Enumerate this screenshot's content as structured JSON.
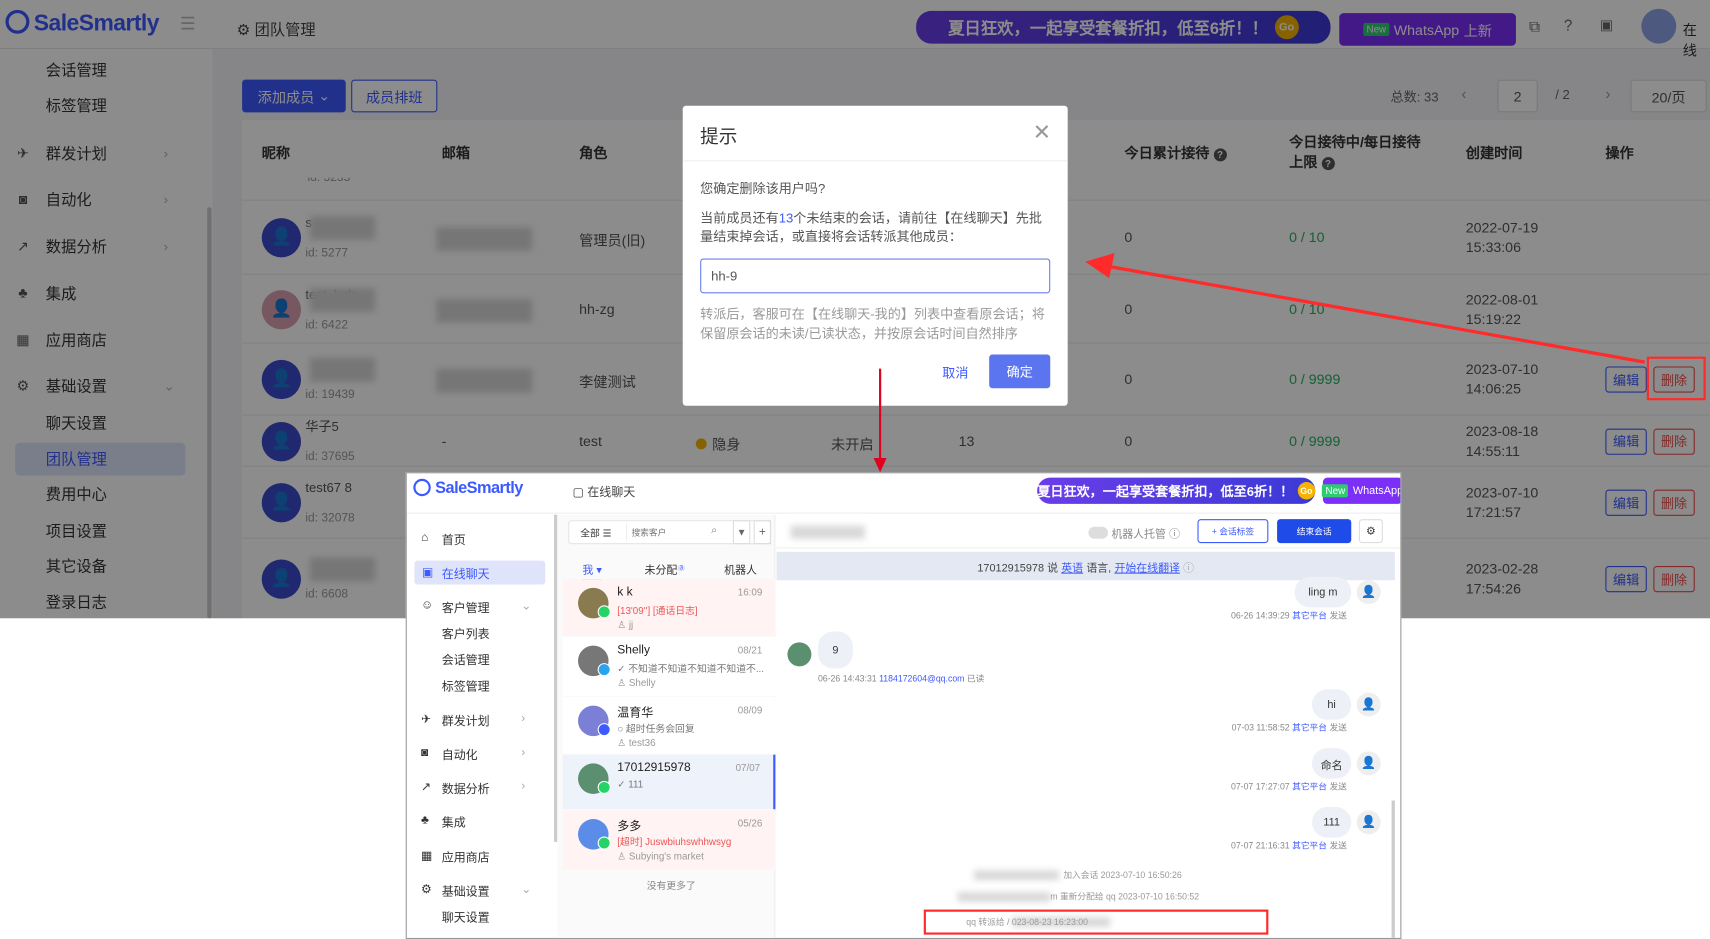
{
  "app": {
    "logo": "SaleSmartly",
    "breadcrumb": "团队管理",
    "banner": "夏日狂欢，一起享受套餐折扣，低至6折！！",
    "banner_go": "Go",
    "wa_new": "New",
    "wa_label": "WhatsApp",
    "wa_suffix": "上新",
    "user_status": "在线"
  },
  "sidebar": [
    {
      "label": "会话管理",
      "icon": ""
    },
    {
      "label": "标签管理",
      "icon": ""
    },
    {
      "label": "群发计划",
      "icon": "send-icon",
      "chevron": "›"
    },
    {
      "label": "自动化",
      "icon": "robot-icon",
      "chevron": "›"
    },
    {
      "label": "数据分析",
      "icon": "chart-icon",
      "chevron": "›"
    },
    {
      "label": "集成",
      "icon": "integration-icon"
    },
    {
      "label": "应用商店",
      "icon": "apps-icon"
    },
    {
      "label": "基础设置",
      "icon": "gear-icon",
      "chevron": "⌄"
    },
    {
      "label": "聊天设置",
      "icon": ""
    },
    {
      "label": "团队管理",
      "icon": "",
      "active": true
    },
    {
      "label": "费用中心",
      "icon": ""
    },
    {
      "label": "项目设置",
      "icon": ""
    },
    {
      "label": "其它设备",
      "icon": ""
    },
    {
      "label": "登录日志",
      "icon": ""
    }
  ],
  "toolbar": {
    "add_member": "添加成员",
    "schedule": "成员排班",
    "total": "总数: 33",
    "page": "2",
    "pages": "/ 2",
    "page_size": "20/页",
    "prev": "‹",
    "next": "›"
  },
  "table": {
    "headers": {
      "nick": "昵称",
      "email": "邮箱",
      "role": "角色",
      "today_total": "今日累计接待",
      "today_limit": "今日接待中/每日接待上限",
      "created": "创建时间",
      "ops": "操作"
    },
    "partial_id": "id: 3235",
    "rows": [
      {
        "name": "s",
        "id": "id: 5277",
        "email": "",
        "role": "管理员(旧)",
        "status": "",
        "auto": "",
        "sessions": "",
        "today": "0",
        "limit": "0 / 10",
        "date": "2022-07-19",
        "time": "15:33:06"
      },
      {
        "name": "test_k dr",
        "id": "id: 6422",
        "email": "",
        "role": "hh-zg",
        "status": "",
        "auto": "",
        "sessions": "",
        "today": "0",
        "limit": "0 / 10",
        "date": "2022-08-01",
        "time": "15:19:22"
      },
      {
        "name": "",
        "id": "id: 19439",
        "email": "",
        "role": "李健测试",
        "status": "",
        "auto": "",
        "sessions": "",
        "today": "0",
        "limit": "0 / 9999",
        "date": "2023-07-10",
        "time": "14:06:25"
      },
      {
        "name": "华子5",
        "id": "id: 37695",
        "email": "-",
        "role": "test",
        "status": "隐身",
        "auto": "未开启",
        "sessions": "13",
        "today": "0",
        "limit": "0 / 9999",
        "date": "2023-08-18",
        "time": "14:55:11"
      },
      {
        "name": "test67 8",
        "id": "id: 32078",
        "email": "",
        "role": "",
        "status": "",
        "auto": "",
        "sessions": "",
        "today": "",
        "limit": "",
        "date": "2023-07-10",
        "time": "17:21:57"
      },
      {
        "name": "",
        "id": "id: 6608",
        "email": "",
        "role": "",
        "status": "",
        "auto": "",
        "sessions": "",
        "today": "",
        "limit": "",
        "date": "2023-02-28",
        "time": "17:54:26"
      }
    ],
    "edit": "编辑",
    "delete": "删除"
  },
  "modal": {
    "title": "提示",
    "question": "您确定删除该用户吗?",
    "info_pre": "当前成员还有",
    "info_count": "13",
    "info_post": "个未结束的会话，请前往【在线聊天】先批量结束掉会话，或直接将会话转派其他成员：",
    "input_value": "hh-9",
    "note": "转派后，客服可在【在线聊天-我的】列表中查看原会话；将保留原会话的未读/已读状态，并按原会话时间自然排序",
    "cancel": "取消",
    "confirm": "确定"
  },
  "inset": {
    "breadcrumb": "在线聊天",
    "sidebar": [
      {
        "label": "首页",
        "icon": "home-icon"
      },
      {
        "label": "在线聊天",
        "icon": "chat-icon",
        "active": true
      },
      {
        "label": "客户管理",
        "icon": "users-icon",
        "chevron": "⌄"
      },
      {
        "label": "客户列表",
        "sub": true
      },
      {
        "label": "会话管理",
        "sub": true
      },
      {
        "label": "标签管理",
        "sub": true
      },
      {
        "label": "群发计划",
        "icon": "send-icon",
        "chevron": "›"
      },
      {
        "label": "自动化",
        "icon": "robot-icon",
        "chevron": "›"
      },
      {
        "label": "数据分析",
        "icon": "chart-icon",
        "chevron": "›"
      },
      {
        "label": "集成",
        "icon": "integration-icon"
      },
      {
        "label": "应用商店",
        "icon": "apps-icon"
      },
      {
        "label": "基础设置",
        "icon": "gear-icon",
        "chevron": "⌄"
      },
      {
        "label": "聊天设置",
        "sub": true
      }
    ],
    "filter": "全部",
    "search_placeholder": "搜索客户",
    "tabs": {
      "me": "我",
      "unassigned": "未分配",
      "unassigned_badge": "3",
      "robot": "机器人"
    },
    "conversations": [
      {
        "name": "k k",
        "time": "16:09",
        "preview": "[13'09''] [通话日志]",
        "agent": "jj",
        "channel": "whatsapp",
        "bg": "#fff3f3"
      },
      {
        "name": "Shelly",
        "time": "08/21",
        "preview": "✓ 不知道不知道不知道不知道不...",
        "agent": "Shelly",
        "channel": "telegram",
        "bg": "#ffffff"
      },
      {
        "name": "温育华",
        "time": "08/09",
        "preview": "○ 超时任务会回复",
        "agent": "test36",
        "channel": "messenger",
        "bg": "#ffffff"
      },
      {
        "name": "17012915978",
        "time": "07/07",
        "preview": "✓ 111",
        "agent": "",
        "channel": "whatsapp",
        "bg": "#eef2fb",
        "selected": true
      },
      {
        "name": "多多",
        "time": "05/26",
        "preview": "[超时] Juswbiuhswhhwsyg",
        "agent": "Subying's market",
        "channel": "whatsapp",
        "bg": "#fff3f3"
      }
    ],
    "no_more": "没有更多了",
    "robot_toggle": "机器人托管",
    "add_tag": "+ 会话标签",
    "end_chat": "结束会话",
    "translate": {
      "pre": "17012915978 说",
      "lang": "英语",
      "mid": "语言,",
      "link": "开始在线翻译"
    },
    "messages": [
      {
        "side": "right",
        "text": "ling m",
        "time": "06-26 14:39:29",
        "platform": "其它平台",
        "status": "发送"
      },
      {
        "side": "left",
        "text": "9",
        "time": "06-26 14:43:31",
        "platform": "1184172604@qq.com",
        "status": "已读"
      },
      {
        "side": "right",
        "text": "hi",
        "time": "07-03 11:58:52",
        "platform": "其它平台",
        "status": "发送"
      },
      {
        "side": "right",
        "text": "命名",
        "time": "07-07 17:27:07",
        "platform": "其它平台",
        "status": "发送"
      },
      {
        "side": "right",
        "text": "111",
        "time": "07-07 21:16:31",
        "platform": "其它平台",
        "status": "发送"
      }
    ],
    "system": [
      "加入会话 2023-07-10 16:50:26",
      "m 重新分配给 qq 2023-07-10 16:50:52",
      "qq 转派给 /  023-08-23 16:23:00"
    ]
  },
  "colors": {
    "primary": "#3d5afe",
    "danger": "#f04b4b",
    "annotation": "#ff2a2a"
  }
}
